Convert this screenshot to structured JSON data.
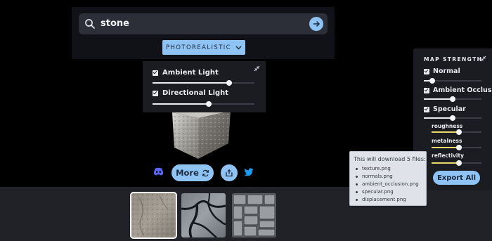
{
  "search": {
    "query": "stone"
  },
  "style_selector": {
    "selected": "PHOTOREALISTIC"
  },
  "lighting": {
    "items": [
      {
        "label": "Ambient Light",
        "checked": true,
        "level": 0.75
      },
      {
        "label": "Directional Light",
        "checked": true,
        "level": 0.55
      }
    ]
  },
  "actions": {
    "more_label": "More"
  },
  "thumbnails": [
    {
      "name": "smooth-stone",
      "selected": true
    },
    {
      "name": "cracked-stone",
      "selected": false
    },
    {
      "name": "stone-tiles",
      "selected": false
    }
  ],
  "map_strength": {
    "title": "MAP STRENGTH",
    "maps": [
      {
        "label": "Normal",
        "checked": true,
        "level": 0.15
      },
      {
        "label": "Ambient Occlusion",
        "checked": true,
        "level": 0.5
      },
      {
        "label": "Specular",
        "checked": true,
        "level": 0.5
      }
    ],
    "sub_sliders": [
      {
        "label": "roughness",
        "level": 0.55
      },
      {
        "label": "metalness",
        "level": 0.55
      },
      {
        "label": "reflectivity",
        "level": 0.55
      }
    ],
    "export_label": "Export All"
  },
  "download_tooltip": {
    "title": "This will download 5 files:",
    "files": [
      "texture.png",
      "normals.png",
      "ambient_occlusion.png",
      "specular.png",
      "displacement.png"
    ]
  },
  "colors": {
    "accent": "#8fc3f4",
    "panel": "#1a1c22",
    "background": "#000000",
    "sub_slider_fill": "#e8d96a"
  }
}
